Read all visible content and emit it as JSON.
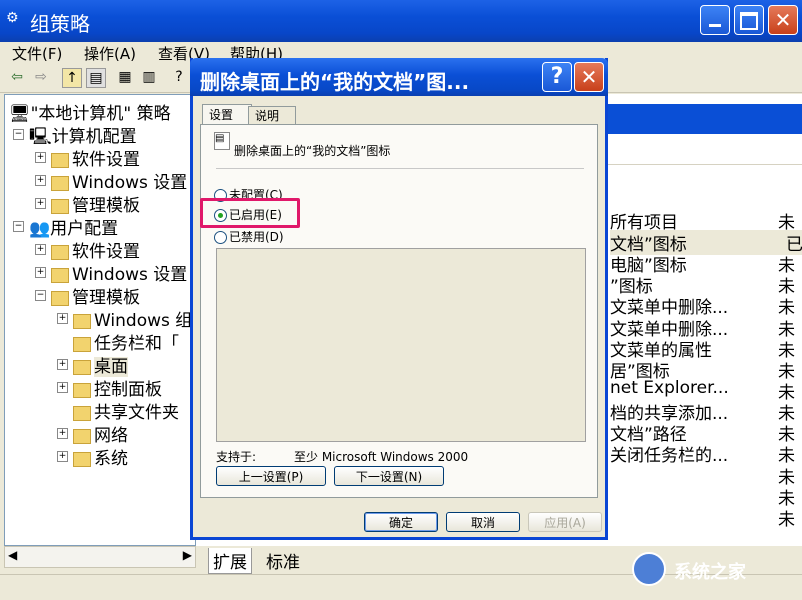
{
  "main_window": {
    "title": "组策略",
    "menu": [
      "文件(F)",
      "操作(A)",
      "查看(V)",
      "帮助(H)"
    ]
  },
  "tree": {
    "root": "\"本地计算机\" 策略",
    "items": [
      "计算机配置",
      "软件设置",
      "Windows 设置",
      "管理模板",
      "用户配置",
      "软件设置",
      "Windows 设置",
      "管理模板",
      "Windows 组",
      "任务栏和「",
      "桌面",
      "控制面板",
      "共享文件夹",
      "网络",
      "系统"
    ]
  },
  "list": {
    "rows": [
      "所有项目",
      "文档”图标",
      "电脑”图标",
      "”图标",
      "文菜单中删除...",
      "文菜单中删除...",
      "文菜单的属性",
      "居”图标",
      "net Explorer...",
      "档的共享添加...",
      "文档”路径",
      "关闭任务栏的..."
    ],
    "states": [
      "未",
      "已",
      "未",
      "未",
      "未",
      "未",
      "未",
      "未",
      "未",
      "未",
      "未",
      "未",
      "未",
      "未",
      "未"
    ]
  },
  "bottom_tabs": [
    "扩展",
    "标准"
  ],
  "dialog": {
    "title": "删除桌面上的“我的文档”图...",
    "tabs": [
      "设置",
      "说明"
    ],
    "setting_name": "删除桌面上的“我的文档”图标",
    "options": [
      "未配置(C)",
      "已启用(E)",
      "已禁用(D)"
    ],
    "selected_option": "已启用(E)",
    "supported_label": "支持于:",
    "supported_value": "至少 Microsoft Windows 2000",
    "prev_button": "上一设置(P)",
    "next_button": "下一设置(N)",
    "ok_button": "确定",
    "cancel_button": "取消",
    "apply_button": "应用(A)"
  },
  "watermark": "系统之家",
  "colors": {
    "title_blue": "#0a4fd6",
    "highlight_pink": "#e0186a"
  }
}
